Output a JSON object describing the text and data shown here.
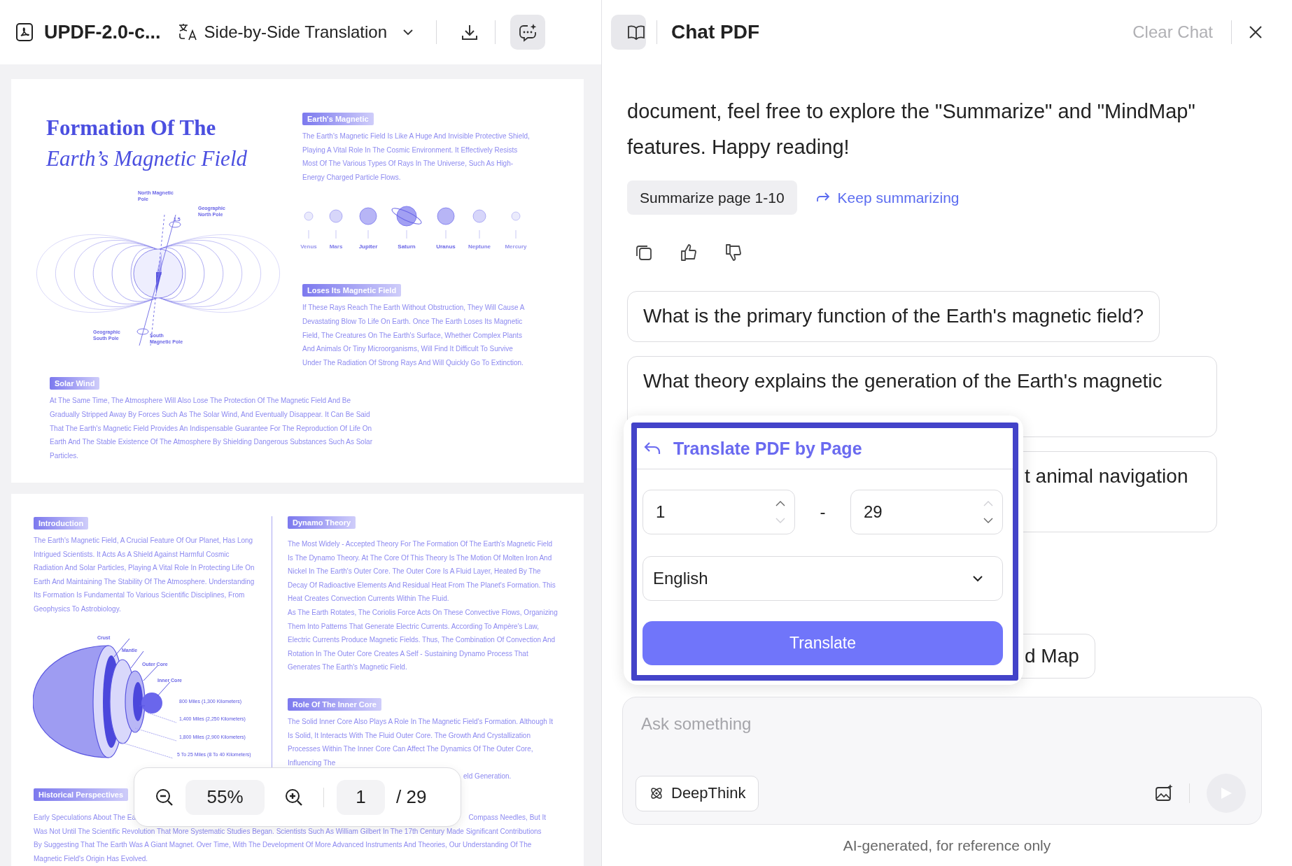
{
  "document": {
    "title": "UPDF-2.0-c...",
    "mode_label": "Side-by-Side Translation",
    "chat_selected": true
  },
  "page_1": {
    "title": [
      "Formation Of The",
      "Earth’s Magnetic Field"
    ],
    "field_labels": [
      "North Magnetic Pole",
      "Geographic North Pole",
      "1.5",
      "Geographic South Pole",
      "South Magnetic Pole"
    ],
    "sections": [
      {
        "tag": "Earth's Magnetic",
        "text": "The Earth's Magnetic Field Is Like A Huge And Invisible Protective Shield, Playing A Vital Role In The Cosmic Environment. It Effectively Resists Most Of The Various Types Of Rays In The Universe, Such As High-Energy Charged Particle Flows."
      },
      {
        "tag": "Loses Its Magnetic Field",
        "text": "If These Rays Reach The Earth Without Obstruction, They Will Cause A Devastating Blow To Life On Earth. Once The Earth Loses Its Magnetic Field, The Creatures On The Earth's Surface, Whether Complex Plants And Animals Or Tiny Microorganisms, Will Find It Difficult To Survive Under The Radiation Of Strong Rays And Will Quickly Go To Extinction."
      }
    ],
    "planets": [
      {
        "name": "Venus"
      },
      {
        "name": "Mars"
      },
      {
        "name": "Jupiter"
      },
      {
        "name": "Saturn"
      },
      {
        "name": "Uranus"
      },
      {
        "name": "Neptune"
      },
      {
        "name": "Mercury"
      }
    ],
    "solar_wind": {
      "tag": "Solar Wind",
      "text": "At The Same Time, The Atmosphere Will Also Lose The Protection Of The Magnetic Field And Be Gradually Stripped Away By Forces Such As The Solar Wind, And Eventually Disappear. It Can Be Said That The Earth's Magnetic Field Provides An Indispensable Guarantee For The Reproduction Of Life On Earth And The Stable Existence Of The Atmosphere By Shielding Dangerous Substances Such As Solar Particles."
    }
  },
  "page_2": {
    "intro": {
      "tag": "Introduction",
      "text": "The Earth's Magnetic Field, A Crucial Feature Of Our Planet, Has Long Intrigued Scientists. It Acts As A Shield Against Harmful Cosmic Radiation And Solar Particles, Playing A Vital Role In Protecting Life On Earth And Maintaining The Stability Of The Atmosphere. Understanding Its Formation Is Fundamental To Various Scientific Disciplines, From Geophysics To Astrobiology."
    },
    "layer_labels": [
      "Crust",
      "Mantle",
      "Outer Core",
      "Inner Core"
    ],
    "depth_labels": [
      "800 Miles (1,300 Kilometers)",
      "1,400 Miles (2,250 Kilometers)",
      "1,800 Miles (2,900 Kilometers)",
      "5 To 25 Miles (8 To 40 Kilometers)"
    ],
    "dynamo": {
      "tag": "Dynamo Theory",
      "paragraphs": [
        "The Most Widely - Accepted Theory For The Formation Of The Earth's Magnetic Field Is The Dynamo Theory. At The Core Of This Theory Is The Motion Of Molten Iron And Nickel In The Earth's Outer Core. The Outer Core Is A Fluid Layer, Heated By The Decay Of Radioactive Elements And Residual Heat From The Planet's Formation. This Heat Creates Convection Currents Within The Fluid.",
        "As The Earth Rotates, The Coriolis Force Acts On These Convective Flows, Organizing Them Into Patterns That Generate Electric Currents. According To Ampère's Law, Electric Currents Produce Magnetic Fields. Thus, The Combination Of Convection And Rotation In The Outer Core Creates A Self - Sustaining Dynamo Process That Generates The Earth's Magnetic Field."
      ]
    },
    "inner_core": {
      "tag": "Role Of The Inner Core",
      "text": "The Solid Inner Core Also Plays A Role In The Magnetic Field's Formation. Although It Is Solid, It Interacts With The Fluid Outer Core. The Growth And Crystallization Processes Within The Inner Core Can Affect The Dynamics Of The Outer Core, Influencing The",
      "tail": "eld Generation."
    },
    "historical": {
      "tag": "Historical Perspectives",
      "first_line": [
        "Early Speculations About The Ea",
        "Compass Needles, But It"
      ],
      "text": "Was Not Until The Scientific Revolution That More Systematic Studies Began. Scientists Such As William Gilbert In The 17th Century Made Significant Contributions By Suggesting That The Earth Was A Giant Magnet. Over Time, With The Development Of More Advanced Instruments And Theories, Our Understanding Of The Magnetic Field's Origin Has Evolved."
    }
  },
  "zoom_bar": {
    "zoom": "55%",
    "page": "1",
    "total": "/ 29"
  },
  "chat": {
    "title": "Chat PDF",
    "clear_label": "Clear Chat",
    "message": "document, feel free to explore the \"Summarize\" and \"MindMap\" features. Happy reading!",
    "summarize_button": "Summarize page 1-10",
    "keep_summarizing": "Keep summarizing",
    "suggestions": [
      {
        "kind": "full",
        "text": "What is the primary function of the Earth's magnetic field?"
      },
      {
        "kind": "full",
        "text": "What theory explains the generation of the Earth's magnetic"
      },
      {
        "kind": "covered",
        "text": "t animal navigation"
      },
      {
        "kind": "covered",
        "text": "d Map"
      }
    ],
    "input": {
      "placeholder": "Ask something"
    },
    "deepthink": {
      "label": "DeepThink",
      "selected": false
    },
    "send_disabled": true,
    "footer": "AI-generated, for reference only"
  },
  "translate_popup": {
    "title": "Translate PDF by Page",
    "range": [
      {
        "value": "1",
        "up_disabled": false,
        "down_disabled": true
      },
      {
        "value": "29",
        "up_disabled": true,
        "down_disabled": false
      }
    ],
    "separator": "-",
    "language": "English",
    "button": "Translate"
  }
}
